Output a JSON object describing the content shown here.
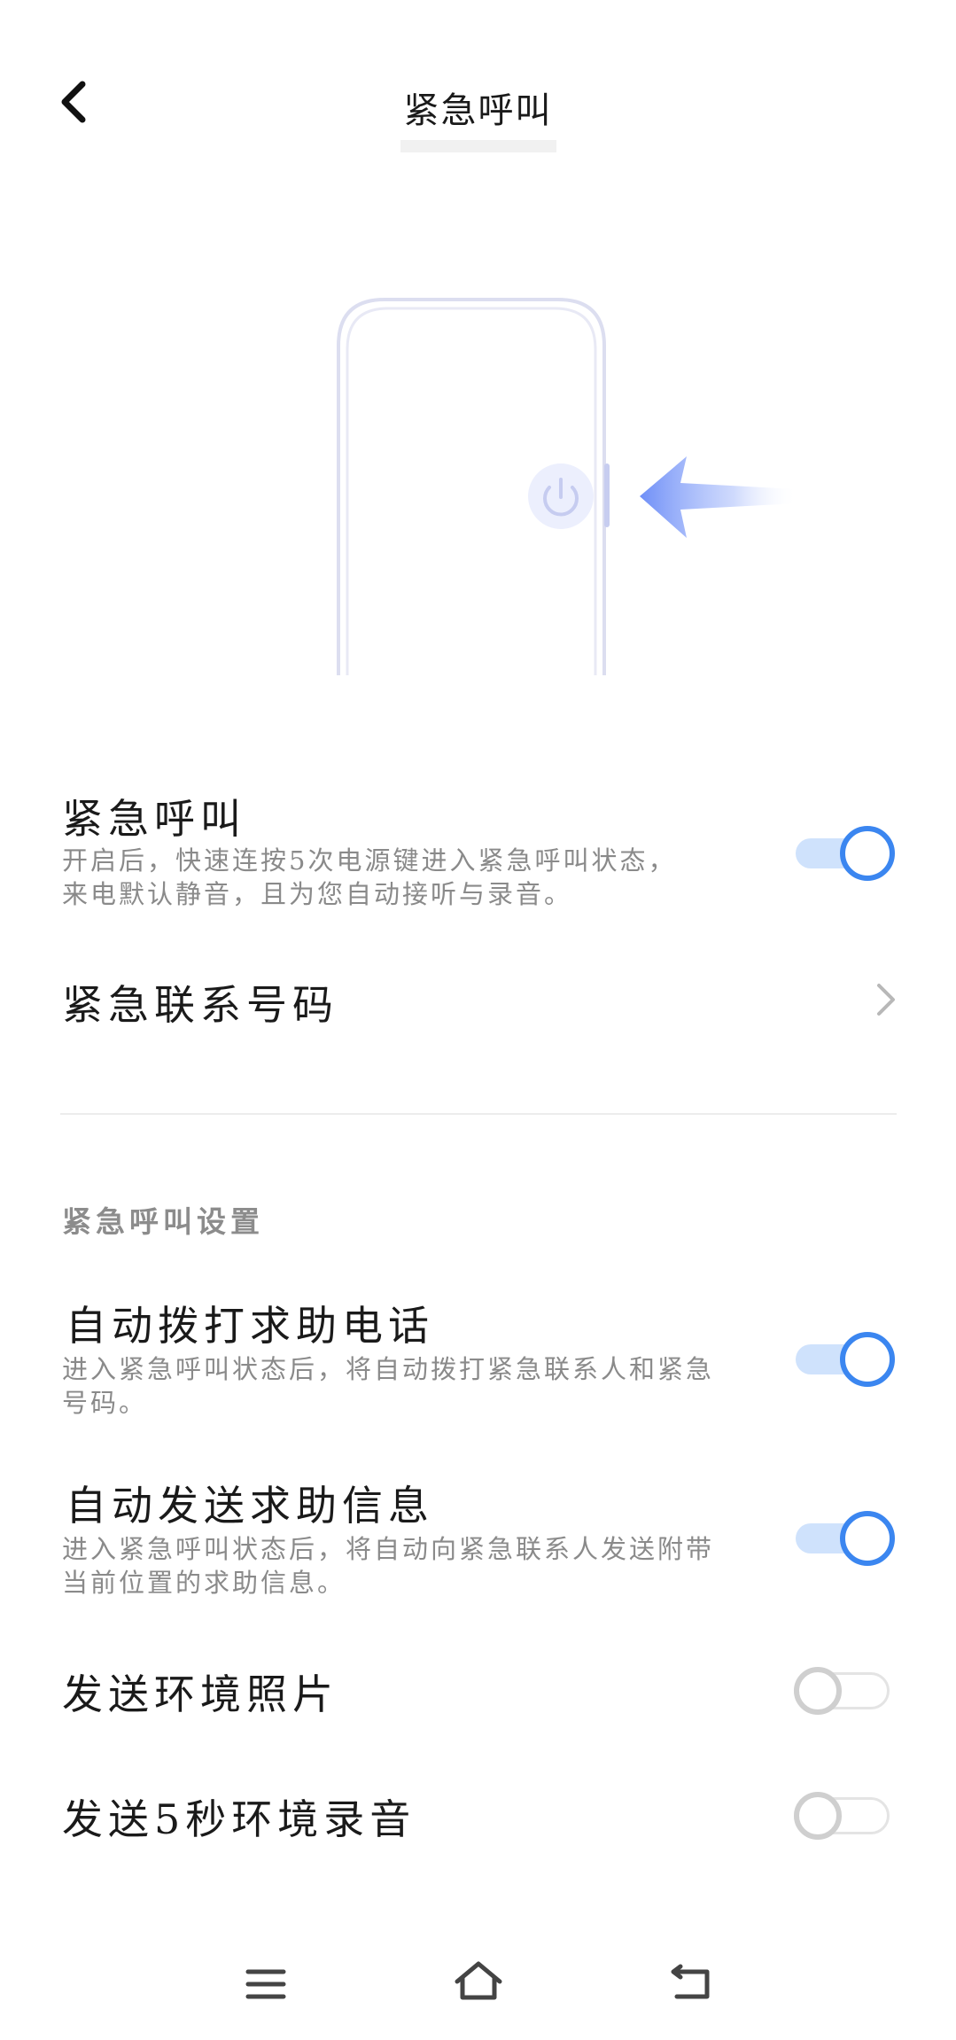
{
  "header": {
    "title": "紧急呼叫",
    "back_icon": "chevron-left-icon"
  },
  "illustration": {
    "icons": [
      "phone-outline",
      "power-icon",
      "arrow-left-icon"
    ],
    "accent_color": "#5b86f5"
  },
  "emergency_call": {
    "title": "紧急呼叫",
    "description": "开启后，快速连按5次电源键进入紧急呼叫状态，来电默认静音，且为您自动接听与录音。",
    "enabled": true
  },
  "emergency_contacts": {
    "title": "紧急联系号码",
    "icon": "chevron-right-icon"
  },
  "settings_section": {
    "header": "紧急呼叫设置",
    "items": [
      {
        "title": "自动拨打求助电话",
        "description": "进入紧急呼叫状态后，将自动拨打紧急联系人和紧急号码。",
        "enabled": true
      },
      {
        "title": "自动发送求助信息",
        "description": "进入紧急呼叫状态后，将自动向紧急联系人发送附带当前位置的求助信息。",
        "enabled": true
      },
      {
        "title": "发送环境照片",
        "enabled": false
      },
      {
        "title": "发送5秒环境录音",
        "enabled": false
      }
    ]
  },
  "nav_bar": {
    "icons": [
      "menu-icon",
      "home-icon",
      "back-icon"
    ]
  },
  "colors": {
    "accent": "#3b86f0",
    "toggle_track_on": "#cfe2fc",
    "toggle_off": "#cfcfcf",
    "secondary_text": "#8a8a8a"
  }
}
